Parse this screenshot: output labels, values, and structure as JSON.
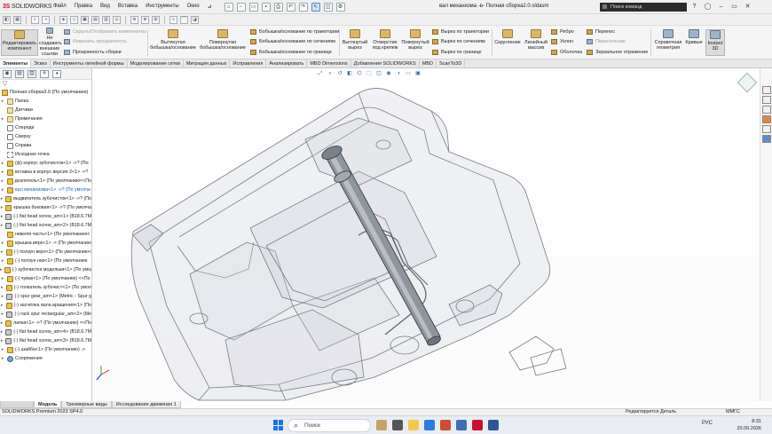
{
  "app": {
    "logo_bold": "3S",
    "logo_rest": "SOLIDWORKS",
    "menus": [
      "Файл",
      "Правка",
      "Вид",
      "Вставка",
      "Инструменты",
      "Окно"
    ],
    "document_title": "вал механизма -в- Полная сборка2.0.sldasm",
    "search_placeholder": "Поиск команд"
  },
  "ribbon": {
    "big": [
      {
        "label1": "Редактировать",
        "label2": "компонент"
      },
      {
        "label1": "Не",
        "label2": "создавать",
        "label3": "внешние",
        "label4": "ссылки"
      },
      {
        "label1": "Вытянутая",
        "label2": "бобышка/основание"
      },
      {
        "label1": "Повернутая",
        "label2": "бобышка/основание"
      },
      {
        "label1": "Вытянутый",
        "label2": "вырез"
      },
      {
        "label1": "Отверстие",
        "label2": "под крепеж"
      },
      {
        "label1": "Повернутый",
        "label2": "вырез"
      },
      {
        "label1": "Скругление",
        "label2": ""
      },
      {
        "label1": "Линейный",
        "label2": "массив"
      },
      {
        "label1": "Справочная",
        "label2": "геометрия"
      },
      {
        "label1": "Кривые",
        "label2": ""
      },
      {
        "label1": "Instant",
        "label2": "3D"
      }
    ],
    "small": {
      "hide_show": "Скрыть/Отобразить компоненты",
      "change_transparency": "Изменить прозрачность",
      "assembly_transparency": "Прозрачность сборки",
      "sweep_boss": "Бобышка/основание по траектории",
      "loft_boss": "Бобышка/основание по сечениям",
      "boundary_boss": "Бобышка/основание по границе",
      "sweep_cut": "Вырез по траектории",
      "loft_cut": "Вырез по сечениям",
      "boundary_cut": "Вырез по границе",
      "rib": "Ребро",
      "draft": "Уклон",
      "shell": "Оболочка",
      "wrap": "Перенос",
      "intersect": "Пересечение",
      "mirror": "Зеркальное отражение"
    }
  },
  "command_tabs": [
    "Элементы",
    "Эскиз",
    "Инструменты литейной формы",
    "Моделирование сетки",
    "Миграция данных",
    "Исправления",
    "Анализировать",
    "MBD Dimensions",
    "Добавления SOLIDWORKS",
    "MBD",
    "ScanTo3D"
  ],
  "tree": {
    "root": "Полная сборка3.0  (По умолчанию)",
    "items": [
      {
        "icon": "fold",
        "exp": "▸",
        "text": "Папка"
      },
      {
        "icon": "fold",
        "exp": "",
        "text": "Датчики"
      },
      {
        "icon": "fold",
        "exp": "▸",
        "text": "Примечания"
      },
      {
        "icon": "plane",
        "exp": "",
        "text": "Спереди"
      },
      {
        "icon": "plane",
        "exp": "",
        "text": "Сверху"
      },
      {
        "icon": "plane",
        "exp": "",
        "text": "Справа"
      },
      {
        "icon": "org",
        "exp": "",
        "text": "Исходная точка"
      },
      {
        "icon": "part",
        "exp": "▸",
        "text": "(ф) корпус зубочисток<1> ->? (По"
      },
      {
        "icon": "part",
        "exp": "▸",
        "text": "вставка в корпус версия 2<1> ->?"
      },
      {
        "icon": "part",
        "exp": "▸",
        "text": "дозлятель<1> (По умолчанию<<По"
      },
      {
        "icon": "part",
        "exp": "▸",
        "text": "вал механизма<1> ->? (По умолча",
        "hl": true
      },
      {
        "icon": "part",
        "exp": "▸",
        "text": "выдвигатель зубочисток<1> ->? (По"
      },
      {
        "icon": "part",
        "exp": "▸",
        "text": "крышка боковая<1> ->? (По умолча"
      },
      {
        "icon": "screw",
        "exp": "▸",
        "text": "(-) flat head screw_am<1> (B18.6.7M"
      },
      {
        "icon": "screw",
        "exp": "▸",
        "text": "(-) flat head screw_am<2> (B18.6.7M"
      },
      {
        "icon": "part",
        "exp": "",
        "text": "нижняя часть<1> (По умолчанию<"
      },
      {
        "icon": "part",
        "exp": "▸",
        "text": "крышка верх<1> -> (По умолчанию"
      },
      {
        "icon": "part",
        "exp": "▸",
        "text": "(-) ползун верх<1> (По умолчанию<"
      },
      {
        "icon": "part",
        "exp": "▸",
        "text": "(-) ползун низ<1> (По умолчанию"
      },
      {
        "icon": "part",
        "exp": "▸",
        "text": "(-) зубочистка модельки<1> (По умол"
      },
      {
        "icon": "part",
        "exp": "▸",
        "text": "(-) чувак<1> (По умолчанию) <<По"
      },
      {
        "icon": "part",
        "exp": "▸",
        "text": "(-) толкатель зубочист<1> (По умол"
      },
      {
        "icon": "screw",
        "exp": "▸",
        "text": "(-) spur gear_am<1> (Metric - Spur g"
      },
      {
        "icon": "part",
        "exp": "▸",
        "text": "(-) засчёлка вала вращения<1> (По"
      },
      {
        "icon": "screw",
        "exp": "▸",
        "text": "(-) rack spur rectangular_am<2> (Me"
      },
      {
        "icon": "part",
        "exp": "▸",
        "text": "лапка<1> ->? (По умолчанию) <<По"
      },
      {
        "icon": "screw",
        "exp": "▸",
        "text": "(-) flat head screw_am<4> (B18.6.7M"
      },
      {
        "icon": "screw",
        "exp": "▸",
        "text": "(-) flat head screw_am<3> (B18.6.7M"
      },
      {
        "icon": "part",
        "exp": "▸",
        "text": "(-) шайба<1> (По умолчанию) ->"
      },
      {
        "icon": "mate",
        "exp": "▸",
        "text": "Сопряжения"
      }
    ]
  },
  "bottom_tabs": [
    "Модель",
    "Трехмерные виды",
    "Исследование движения 1"
  ],
  "status": {
    "version": "SOLIDWORKS Premium 2023 SP4.0",
    "mode": "Редактируется Деталь",
    "units": "ММГС"
  },
  "taskbar": {
    "search": "Поиск",
    "lang": "РУС",
    "time": "8:31",
    "date": "20.09.2026"
  }
}
